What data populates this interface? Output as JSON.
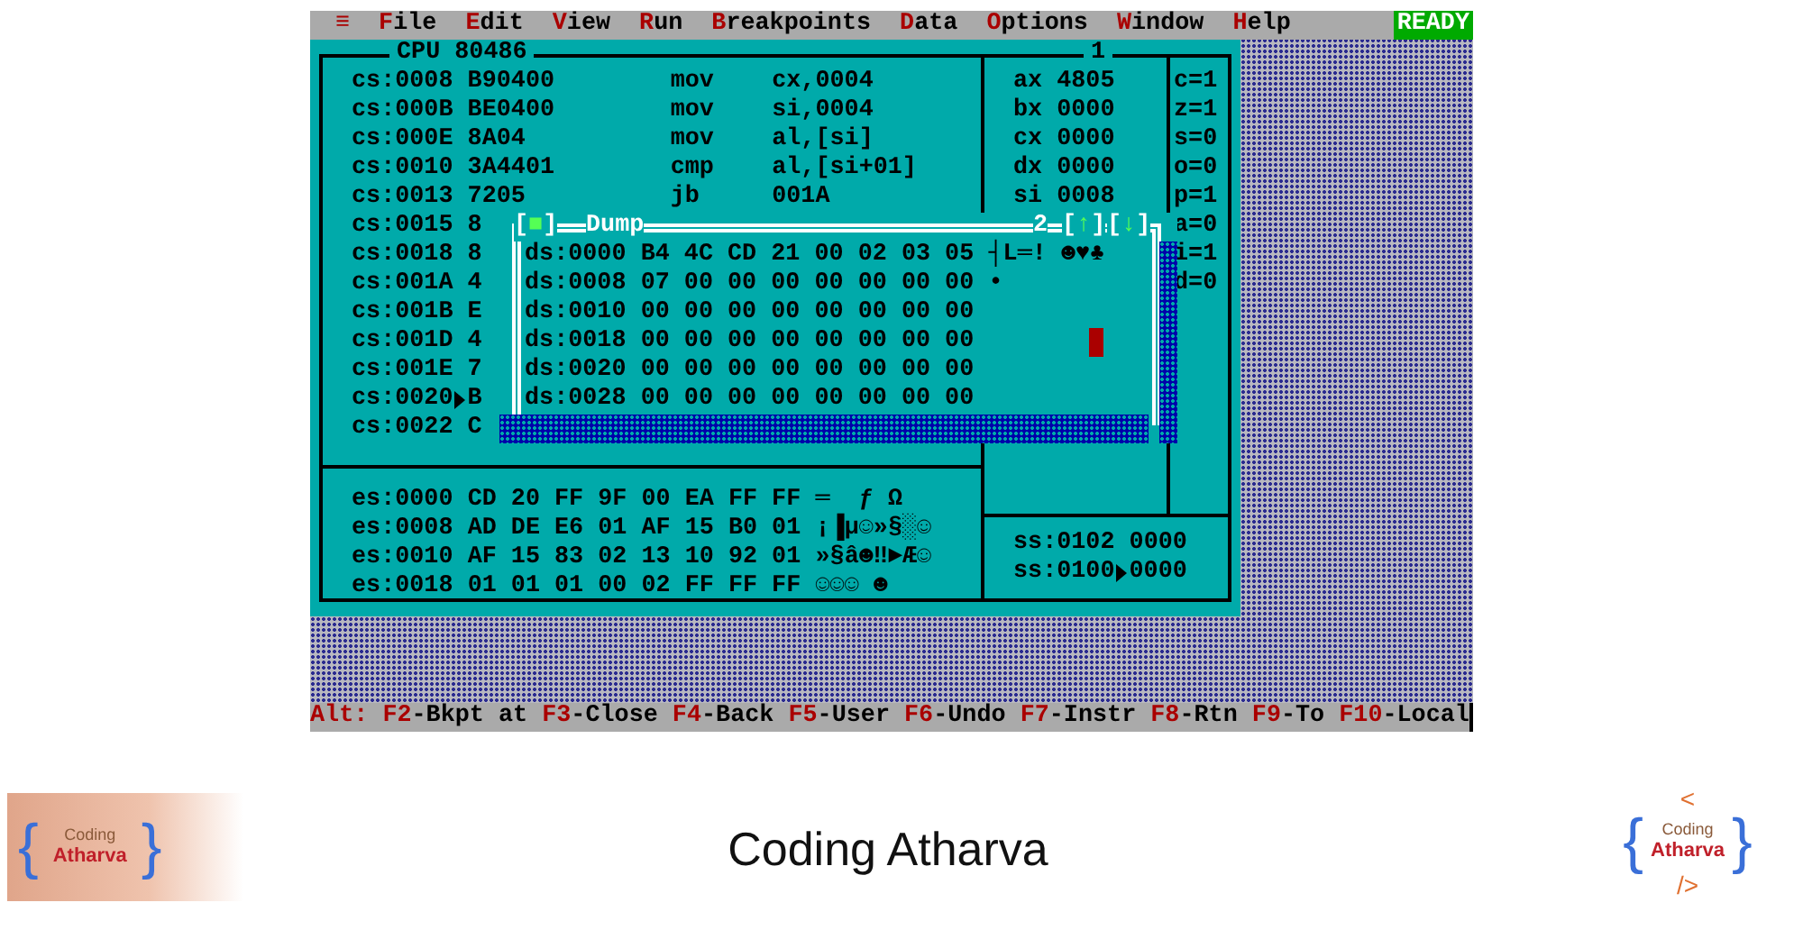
{
  "menu_bar": {
    "system_menu": "≡",
    "items": [
      {
        "label": "File"
      },
      {
        "label": "Edit"
      },
      {
        "label": "View"
      },
      {
        "label": "Run"
      },
      {
        "label": "Breakpoints"
      },
      {
        "label": "Data"
      },
      {
        "label": "Options"
      },
      {
        "label": "Window"
      },
      {
        "label": "Help"
      }
    ],
    "status": "READY"
  },
  "cpu_window": {
    "title": "CPU 80486",
    "number": "1",
    "code_lines": [
      {
        "address": "cs:0008",
        "bytes": "B90400",
        "mnemonic": "mov",
        "operands": "cx,0004",
        "current": false
      },
      {
        "address": "cs:000B",
        "bytes": "BE0400",
        "mnemonic": "mov",
        "operands": "si,0004",
        "current": false
      },
      {
        "address": "cs:000E",
        "bytes": "8A04",
        "mnemonic": "mov",
        "operands": "al,[si]",
        "current": false
      },
      {
        "address": "cs:0010",
        "bytes": "3A4401",
        "mnemonic": "cmp",
        "operands": "al,[si+01]",
        "current": false
      },
      {
        "address": "cs:0013",
        "bytes": "7205",
        "mnemonic": "jb",
        "operands": "001A",
        "current": false
      },
      {
        "address": "cs:0015",
        "bytes": "8",
        "current": false
      },
      {
        "address": "cs:0018",
        "bytes": "8",
        "current": false
      },
      {
        "address": "cs:001A",
        "bytes": "4",
        "current": false
      },
      {
        "address": "cs:001B",
        "bytes": "E",
        "current": false
      },
      {
        "address": "cs:001D",
        "bytes": "4",
        "current": false
      },
      {
        "address": "cs:001E",
        "bytes": "7",
        "current": false
      },
      {
        "address": "cs:0020",
        "bytes": "B",
        "current": true
      },
      {
        "address": "cs:0022",
        "bytes": "C",
        "current": false
      }
    ],
    "registers": [
      {
        "name": "ax",
        "value": "4805"
      },
      {
        "name": "bx",
        "value": "0000"
      },
      {
        "name": "cx",
        "value": "0000"
      },
      {
        "name": "dx",
        "value": "0000"
      },
      {
        "name": "si",
        "value": "0008"
      }
    ],
    "flags": [
      "c=1",
      "z=1",
      "s=0",
      "o=0",
      "p=1",
      "a=0",
      "i=1",
      "d=0"
    ],
    "data_lines": [
      {
        "address": "es:0000",
        "bytes": "CD 20 FF 9F 00 EA FF FF",
        "chars": "═  ƒ Ω"
      },
      {
        "address": "es:0008",
        "bytes": "AD DE E6 01 AF 15 B0 01",
        "chars": "¡▐µ☺»§░☺"
      },
      {
        "address": "es:0010",
        "bytes": "AF 15 83 02 13 10 92 01",
        "chars": "»§â☻‼►Æ☺"
      },
      {
        "address": "es:0018",
        "bytes": "01 01 01 00 02 FF FF FF",
        "chars": "☺☺☺ ☻"
      }
    ],
    "stack_lines": [
      {
        "address": "ss:0102",
        "value": "0000",
        "current": false
      },
      {
        "address": "ss:0100",
        "value": "0000",
        "current": true
      }
    ]
  },
  "dump_window": {
    "close_box": "[■]",
    "title": "Dump",
    "number": "2",
    "scroll_up": "[↑]",
    "scroll_down": "[↓]",
    "lines": [
      {
        "address": "ds:0000",
        "bytes": "B4 4C CD 21 00 02 03 05",
        "chars": "┤L═! ☻♥♣"
      },
      {
        "address": "ds:0008",
        "bytes": "07 00 00 00 00 00 00 00",
        "chars": "•"
      },
      {
        "address": "ds:0010",
        "bytes": "00 00 00 00 00 00 00 00"
      },
      {
        "address": "ds:0018",
        "bytes": "00 00 00 00 00 00 00 00"
      },
      {
        "address": "ds:0020",
        "bytes": "00 00 00 00 00 00 00 00"
      },
      {
        "address": "ds:0028",
        "bytes": "00 00 00 00 00 00 00 00"
      }
    ]
  },
  "status_bar": {
    "prefix": "Alt:",
    "keys": [
      {
        "key": "F2",
        "label": "-Bkpt at"
      },
      {
        "key": "F3",
        "label": "-Close"
      },
      {
        "key": "F4",
        "label": "-Back"
      },
      {
        "key": "F5",
        "label": "-User"
      },
      {
        "key": "F6",
        "label": "-Undo"
      },
      {
        "key": "F7",
        "label": "-Instr"
      },
      {
        "key": "F8",
        "label": "-Rtn"
      },
      {
        "key": "F9",
        "label": "-To"
      },
      {
        "key": "F10",
        "label": "-Local"
      }
    ]
  },
  "slide": {
    "left_logo": {
      "open_brace": "{",
      "close_brace": "}",
      "word_top": "Coding",
      "word_bottom": "Atharva"
    },
    "caption": "Coding Atharva",
    "right_logo": {
      "open_tag": "<",
      "open_brace": "{",
      "close_brace": "}",
      "word_top": "Coding",
      "word_bottom": "Atharva",
      "close_tag": "/>"
    }
  }
}
